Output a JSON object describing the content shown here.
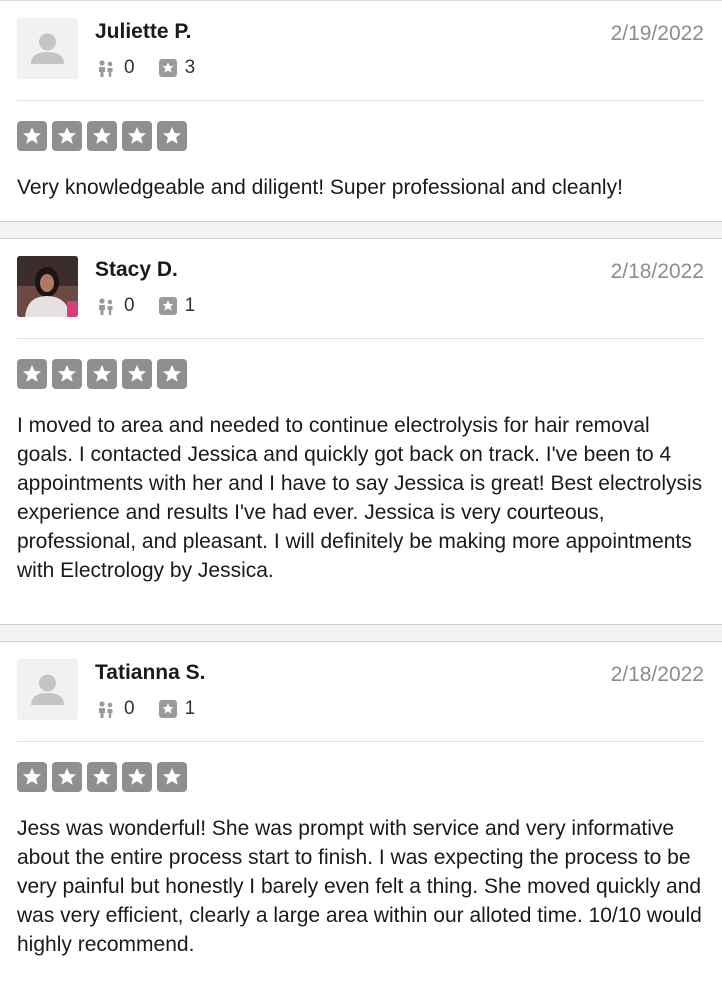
{
  "reviews": [
    {
      "name": "Juliette P.",
      "date": "2/19/2022",
      "friends": "0",
      "reviews_count": "3",
      "rating": 5,
      "avatar_icon": "default-user-icon",
      "text": "Very knowledgeable and diligent! Super professional and cleanly!"
    },
    {
      "name": "Stacy D.",
      "date": "2/18/2022",
      "friends": "0",
      "reviews_count": "1",
      "rating": 5,
      "avatar_icon": "user-photo",
      "text": "I moved to area and needed to continue electrolysis for hair removal goals. I contacted Jessica and quickly got back on track. I've been to 4 appointments with her and I have to say Jessica is great! Best electrolysis experience and results I've had ever. Jessica is very courteous, professional, and pleasant. I will definitely be making more appointments with Electrology by Jessica."
    },
    {
      "name": "Tatianna S.",
      "date": "2/18/2022",
      "friends": "0",
      "reviews_count": "1",
      "rating": 5,
      "avatar_icon": "default-user-icon",
      "text": "Jess was wonderful! She was prompt with service and very informative about the entire process start to finish. I was expecting the process to be very painful but honestly I barely even felt a thing. She moved quickly and was very efficient, clearly a large area within our alloted time. 10/10 would highly recommend."
    }
  ],
  "colors": {
    "star_box": "#8f8f8f",
    "date": "#8d8d8d",
    "separator": "#f2f2f2"
  }
}
